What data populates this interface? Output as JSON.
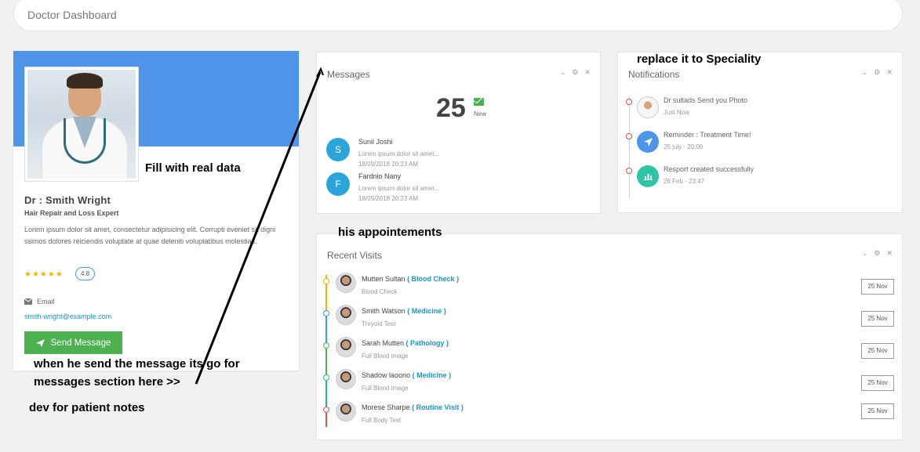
{
  "header": {
    "title": "Doctor Dashboard"
  },
  "profile": {
    "name": "Dr : Smith Wright",
    "role": "Hair Repair and Loss Expert",
    "bio": "Lorem ipsum dolor sit amet, consectetur adipisicing elit. Corrupti eveniet sit digni ssimos dolores reiciendis voluptate at quae deleniti voluptatibus molestias.",
    "stars": "★★★★★",
    "rating": "4.8",
    "email_label": "Email",
    "email": "smith-wright@example.com",
    "send_label": "Send Message"
  },
  "messages": {
    "title": "Messages",
    "count": "25",
    "count_label": "New",
    "items": [
      {
        "initial": "S",
        "name": "Sunil Joshi",
        "preview": "Lorem ipsum dolor sit amet...",
        "date": "18/09/2018 20:23 AM"
      },
      {
        "initial": "F",
        "name": "Fardnio Nany",
        "preview": "Lorem ipsum dolor sit amet...",
        "date": "18/09/2018 20:23 AM"
      }
    ]
  },
  "notifications": {
    "title": "Notifications",
    "items": [
      {
        "title": "Dr sultads Send you Photo",
        "sub": "Just Now",
        "icon": "doctor-photo-icon",
        "color": "#e8eef5"
      },
      {
        "title": "Reminder : Treatment Time!",
        "sub": "25 july · 20:00",
        "icon": "send-icon",
        "color": "#4e95ea"
      },
      {
        "title": "Resport created successfully",
        "sub": "26 Feb · 23:47",
        "icon": "chart-icon",
        "color": "#2ec4a6"
      }
    ]
  },
  "visits": {
    "title": "Recent Visits",
    "items": [
      {
        "name": "Mutten Sultan",
        "category": "( Blood Check )",
        "sub": "Blood Check",
        "date": "25 Nov",
        "color": "#f0b400"
      },
      {
        "name": "Smith Watson",
        "category": "( Medicine )",
        "sub": "Thryoid Test",
        "date": "25 Nov",
        "color": "#2aa5db"
      },
      {
        "name": "Sarah Mutten",
        "category": "( Pathology )",
        "sub": "Full Blood image",
        "date": "25 Nov",
        "color": "#4caf50"
      },
      {
        "name": "Shadow laoono",
        "category": "( Medicine )",
        "sub": "Full Blood image",
        "date": "25 Nov",
        "color": "#1abc9c"
      },
      {
        "name": "Morese Sharpe",
        "category": "( Routine Visit )",
        "sub": "Full Body Test",
        "date": "25 Nov",
        "color": "#d9534f"
      }
    ]
  },
  "annotations": {
    "speciality": "replace it to Speciality",
    "real_data": "Fill with real data",
    "appointments": "his appointements",
    "send_note_1": "when he send the message its go for",
    "send_note_2": "messages section here >>",
    "patient_notes": "dev for patient notes"
  },
  "colors": {
    "primary": "#4e95ea",
    "success": "#4caf50",
    "link": "#1a95c9"
  }
}
